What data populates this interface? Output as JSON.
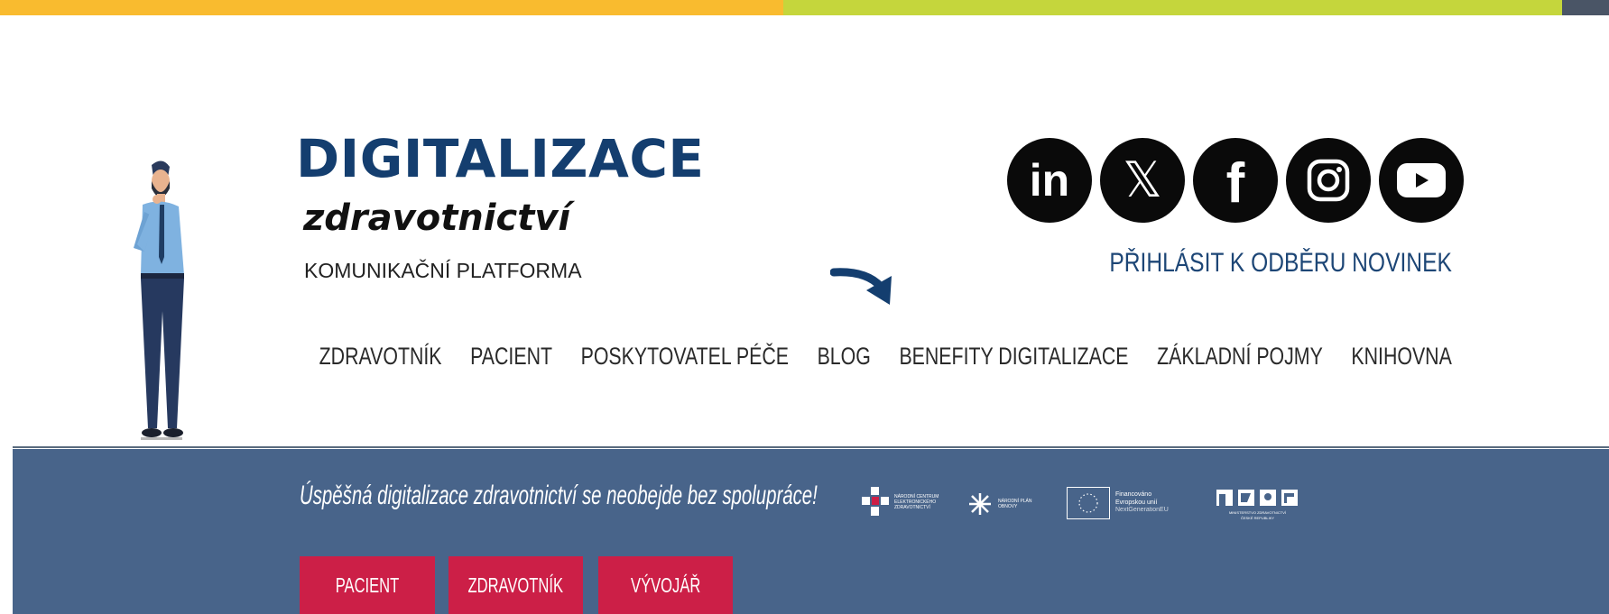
{
  "header": {
    "logo": {
      "title": "DIGITALIZACE",
      "subtitle": "zdravotnictví",
      "tagline": "KOMUNIKAČNÍ PLATFORMA"
    },
    "socials": [
      {
        "name": "linkedin-icon",
        "glyph": "in"
      },
      {
        "name": "x-twitter-icon",
        "glyph": "𝕏"
      },
      {
        "name": "facebook-icon",
        "glyph": "f"
      },
      {
        "name": "instagram-icon",
        "glyph": ""
      },
      {
        "name": "youtube-icon",
        "glyph": ""
      }
    ],
    "subscribe_label": "PŘIHLÁSIT K ODBĚRU NOVINEK"
  },
  "nav": {
    "items": [
      {
        "label": "ZDRAVOTNÍK"
      },
      {
        "label": "PACIENT"
      },
      {
        "label": "POSKYTOVATEL PÉČE"
      },
      {
        "label": "BLOG"
      },
      {
        "label": "BENEFITY DIGITALIZACE"
      },
      {
        "label": "ZÁKLADNÍ POJMY"
      },
      {
        "label": "KNIHOVNA"
      }
    ]
  },
  "band": {
    "slogan": "Úspěšná digitalizace zdravotnictví se neobejde bez spolupráce!",
    "partners": {
      "nceez": "NÁRODNÍ CENTRUM ELEKTRONICKÉHO ZDRAVOTNICTVÍ",
      "npo": "NÁRODNÍ PLÁN OBNOVY",
      "eu_line1": "Financováno",
      "eu_line2": "Evropskou unií",
      "eu_line3": "NextGenerationEU",
      "mzcr_line1": "MINISTERSTVO ZDRAVOTNICTVÍ",
      "mzcr_line2": "ČESKÉ REPUBLIKY"
    },
    "buttons": [
      {
        "label": "PACIENT"
      },
      {
        "label": "ZDRAVOTNÍK"
      },
      {
        "label": "VÝVOJÁŘ"
      }
    ]
  },
  "colors": {
    "top_bar_yellow": "#f9bb2f",
    "top_bar_green": "#c5d63c",
    "top_bar_dark": "#4a5566",
    "logo_blue": "#143e6f",
    "band_blue": "#48648a",
    "button_red": "#cc1f47"
  }
}
